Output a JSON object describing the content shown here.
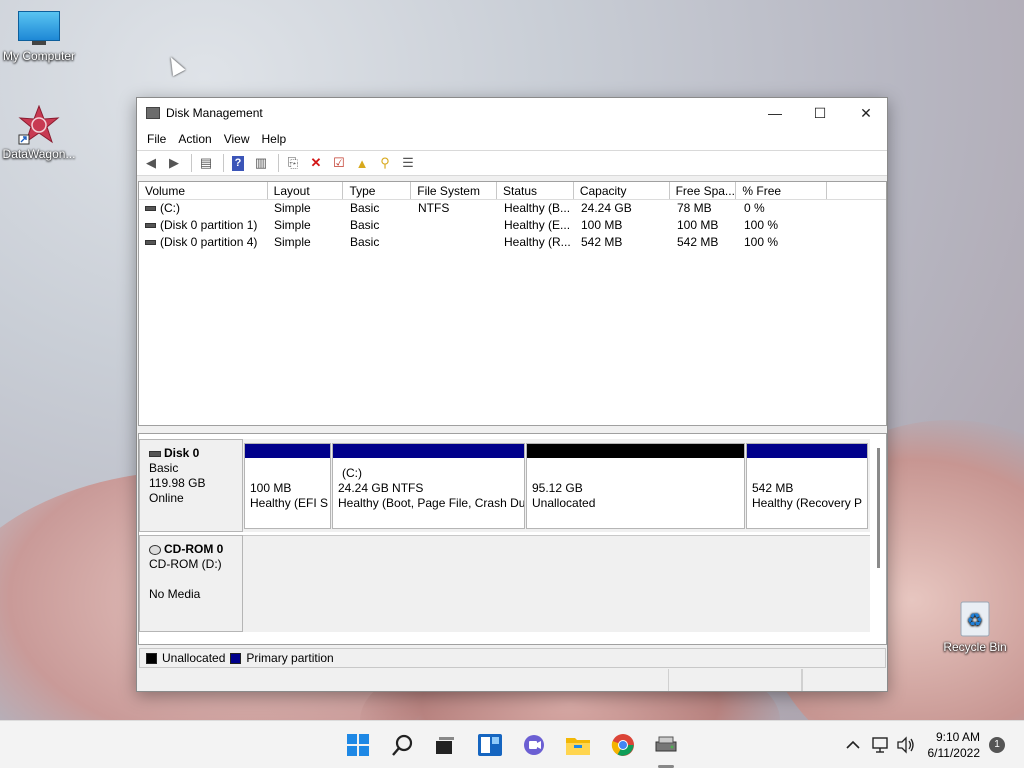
{
  "desktop": {
    "icons": [
      {
        "label": "My Computer"
      },
      {
        "label": "DataWagon..."
      },
      {
        "label": "Recycle Bin"
      }
    ]
  },
  "window": {
    "title": "Disk Management",
    "controls": {
      "minimize": "—",
      "maximize": "☐",
      "close": "✕"
    },
    "menu": [
      "File",
      "Action",
      "View",
      "Help"
    ],
    "toolbar_icons": [
      "back-icon",
      "forward-icon",
      "console-tree-icon",
      "help-icon",
      "properties-icon",
      "connect-disk-icon",
      "delete-icon",
      "check-icon",
      "import-icon",
      "search-disk-icon",
      "settings-icon"
    ]
  },
  "volume_list": {
    "columns": [
      "Volume",
      "Layout",
      "Type",
      "File System",
      "Status",
      "Capacity",
      "Free Spa...",
      "% Free"
    ],
    "rows": [
      [
        "(C:)",
        "Simple",
        "Basic",
        "NTFS",
        "Healthy (B...",
        "24.24 GB",
        "78 MB",
        "0 %"
      ],
      [
        "(Disk 0 partition 1)",
        "Simple",
        "Basic",
        "",
        "Healthy (E...",
        "100 MB",
        "100 MB",
        "100 %"
      ],
      [
        "(Disk 0 partition 4)",
        "Simple",
        "Basic",
        "",
        "Healthy (R...",
        "542 MB",
        "542 MB",
        "100 %"
      ]
    ]
  },
  "disks": [
    {
      "name": "Disk 0",
      "type": "Basic",
      "size": "119.98 GB",
      "state": "Online",
      "partitions": [
        {
          "title": "",
          "line1": "100 MB",
          "line2": "Healthy (EFI S",
          "color": "#00008b"
        },
        {
          "title": "(C:)",
          "line1": "24.24 GB NTFS",
          "line2": "Healthy (Boot, Page File, Crash Du",
          "color": "#00008b"
        },
        {
          "title": "",
          "line1": "95.12 GB",
          "line2": "Unallocated",
          "color": "#000000"
        },
        {
          "title": "",
          "line1": "542 MB",
          "line2": "Healthy (Recovery P",
          "color": "#00008b"
        }
      ]
    },
    {
      "name": "CD-ROM 0",
      "type": "CD-ROM (D:)",
      "size": "",
      "state": "No Media"
    }
  ],
  "legend": [
    {
      "label": "Unallocated",
      "color": "#000000"
    },
    {
      "label": "Primary partition",
      "color": "#00008b"
    }
  ],
  "taskbar": {
    "time": "9:10 AM",
    "date": "6/11/2022",
    "notification_count": "1",
    "apps": [
      "start-icon",
      "search-icon",
      "task-view-icon",
      "widgets-icon",
      "chat-icon",
      "file-explorer-icon",
      "chrome-icon",
      "disk-management-icon"
    ]
  }
}
